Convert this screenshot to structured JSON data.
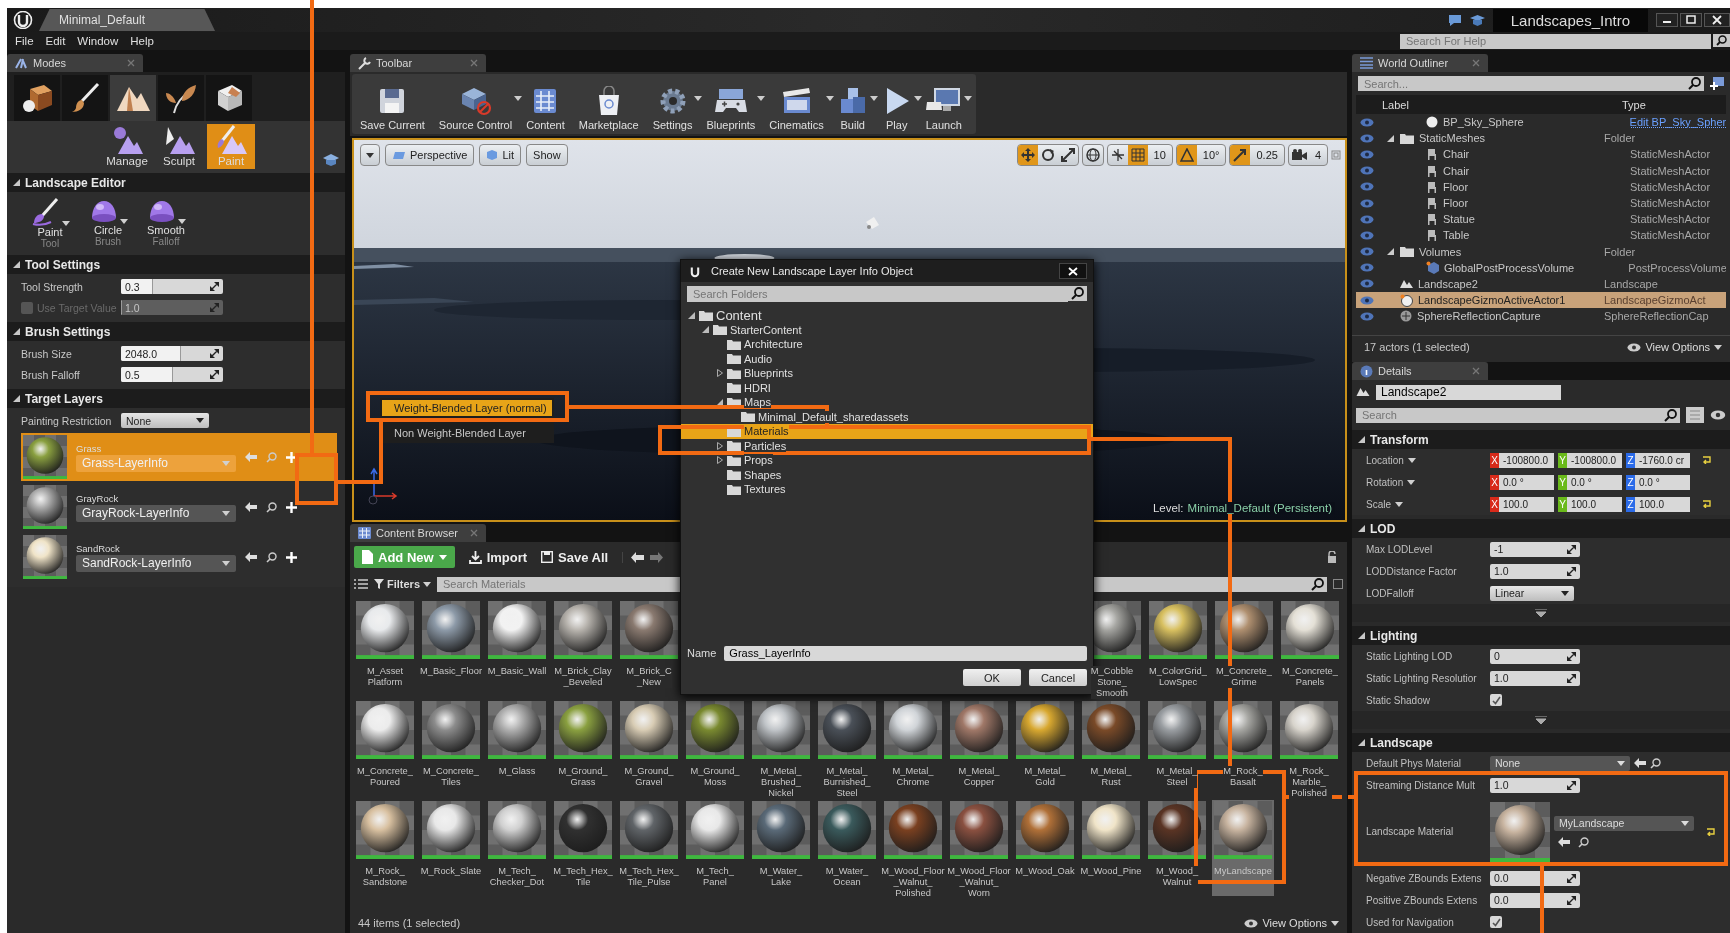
{
  "title_bar": {
    "document_tab": "Minimal_Default",
    "project": "Landscapes_Intro",
    "help_search": {
      "placeholder": "Search For Help"
    }
  },
  "menu": [
    "File",
    "Edit",
    "Window",
    "Help"
  ],
  "modes": {
    "tab": "Modes",
    "mode_buttons": [
      {
        "kind": "place",
        "selected": false
      },
      {
        "kind": "paint",
        "selected": false
      },
      {
        "kind": "landscape",
        "selected": true
      },
      {
        "kind": "foliage",
        "selected": false
      },
      {
        "kind": "geometry",
        "selected": false
      }
    ],
    "sub_modes": [
      {
        "kind": "manage",
        "label": "Manage",
        "selected": false
      },
      {
        "kind": "sculpt",
        "label": "Sculpt",
        "selected": false
      },
      {
        "kind": "paint",
        "label": "Paint",
        "selected": true
      }
    ],
    "landscape_editor": {
      "title": "Landscape Editor",
      "tools": [
        {
          "kind": "brush",
          "label": "Paint",
          "sublabel": "Tool"
        },
        {
          "kind": "dome",
          "label": "Circle",
          "sublabel": "Brush"
        },
        {
          "kind": "dome",
          "label": "Smooth",
          "sublabel": "Falloff"
        }
      ]
    },
    "tool_settings": {
      "title": "Tool Settings",
      "rows": [
        {
          "kind": "slider",
          "label": "Tool Strength",
          "value": "0.3",
          "level": 0.3,
          "disabled": false
        },
        {
          "kind": "checkbox-slider",
          "label": "Use Target Value",
          "value": "1.0",
          "level": 0,
          "disabled": true,
          "checked": false
        }
      ]
    },
    "brush_settings": {
      "title": "Brush Settings",
      "rows": [
        {
          "kind": "slider",
          "label": "Brush Size",
          "value": "2048.0",
          "level": 0.58,
          "disabled": false
        },
        {
          "kind": "slider",
          "label": "Brush Falloff",
          "value": "0.5",
          "level": 0.5,
          "disabled": false
        }
      ]
    },
    "target_layers": {
      "title": "Target Layers",
      "restriction": {
        "label": "Painting Restriction",
        "value": "None"
      },
      "layers": [
        {
          "name": "Grass",
          "info": "Grass-LayerInfo",
          "selected": true
        },
        {
          "name": "GrayRock",
          "info": "GrayRock-LayerInfo",
          "selected": false
        },
        {
          "name": "SandRock",
          "info": "SandRock-LayerInfo",
          "selected": false
        }
      ]
    }
  },
  "toolbar": {
    "tab": "Toolbar",
    "buttons": [
      {
        "kind": "save",
        "label": "Save Current",
        "dropdown": false
      },
      {
        "kind": "source-control",
        "label": "Source Control",
        "dropdown": true
      },
      {
        "kind": "content",
        "label": "Content",
        "dropdown": false
      },
      {
        "kind": "marketplace",
        "label": "Marketplace",
        "dropdown": false
      },
      {
        "kind": "settings",
        "label": "Settings",
        "dropdown": true
      },
      {
        "kind": "blueprints",
        "label": "Blueprints",
        "dropdown": true
      },
      {
        "kind": "cinematics",
        "label": "Cinematics",
        "dropdown": true
      },
      {
        "kind": "build",
        "label": "Build",
        "dropdown": true
      },
      {
        "kind": "play",
        "label": "Play",
        "dropdown": true
      },
      {
        "kind": "launch",
        "label": "Launch",
        "dropdown": true
      }
    ]
  },
  "viewport": {
    "view_buttons": [
      {
        "kind": "perspective",
        "label": "Perspective"
      },
      {
        "kind": "lit",
        "label": "Lit"
      },
      {
        "kind": "show",
        "label": "Show"
      }
    ],
    "transform_tools": [
      {
        "kind": "move",
        "selected": true
      },
      {
        "kind": "rotate",
        "selected": false
      },
      {
        "kind": "scale",
        "selected": false
      }
    ],
    "snaps": [
      {
        "kind": "grid",
        "value": "10",
        "on": true
      },
      {
        "kind": "rotation",
        "value": "10°",
        "on": true
      },
      {
        "kind": "scale",
        "value": "0.25",
        "on": true
      },
      {
        "kind": "camera-speed",
        "value": "4",
        "on": false
      }
    ],
    "level": {
      "label": "Level:",
      "name": "Minimal_Default (Persistent)"
    },
    "layer_menu": [
      {
        "label": "Weight-Blended Layer (normal)",
        "selected": true
      },
      {
        "label": "Non Weight-Blended Layer",
        "selected": false
      }
    ]
  },
  "content_browser": {
    "tab": "Content Browser",
    "add_new": "Add New",
    "import": "Import",
    "save_all": "Save All",
    "filters": "Filters",
    "search": {
      "placeholder": "Search Materials"
    },
    "first_row_left": [
      {
        "label": "M_Asset\nPlatform",
        "selected": false
      },
      {
        "label": "M_Basic_Floor",
        "selected": false
      },
      {
        "label": "M_Basic_Wall",
        "selected": false
      },
      {
        "label": "M_Brick_Clay\n_Beveled",
        "selected": false
      },
      {
        "label": "M_Brick_C\n_New",
        "selected": false
      }
    ],
    "first_row_right": [
      {
        "label": "M_Cobble\nStone_\nSmooth",
        "selected": false
      },
      {
        "label": "M_ColorGrid_\nLowSpec",
        "selected": false
      },
      {
        "label": "M_Concrete_\nGrime",
        "selected": false
      },
      {
        "label": "M_Concrete_\nPanels",
        "selected": false
      }
    ],
    "rows": [
      [
        {
          "label": "M_Concrete_\nPoured",
          "selected": false
        },
        {
          "label": "M_Concrete_\nTiles",
          "selected": false
        },
        {
          "label": "M_Glass",
          "selected": false
        },
        {
          "label": "M_Ground_\nGrass",
          "selected": false
        },
        {
          "label": "M_Ground_\nGravel",
          "selected": false
        },
        {
          "label": "M_Ground_\nMoss",
          "selected": false
        },
        {
          "label": "M_Metal_\nBrushed_\nNickel",
          "selected": false
        },
        {
          "label": "M_Metal_\nBurnished_\nSteel",
          "selected": false
        },
        {
          "label": "M_Metal_\nChrome",
          "selected": false
        },
        {
          "label": "M_Metal_\nCopper",
          "selected": false
        },
        {
          "label": "M_Metal_\nGold",
          "selected": false
        },
        {
          "label": "M_Metal_\nRust",
          "selected": false
        },
        {
          "label": "M_Metal_\nSteel",
          "selected": false
        },
        {
          "label": "M_Rock_\nBasalt",
          "selected": false
        },
        {
          "label": "M_Rock_\nMarble_\nPolished",
          "selected": false
        }
      ],
      [
        {
          "label": "M_Rock_\nSandstone",
          "selected": false
        },
        {
          "label": "M_Rock_Slate",
          "selected": false
        },
        {
          "label": "M_Tech_\nChecker_Dot",
          "selected": false
        },
        {
          "label": "M_Tech_Hex_\nTile",
          "selected": false
        },
        {
          "label": "M_Tech_Hex_\nTile_Pulse",
          "selected": false
        },
        {
          "label": "M_Tech_\nPanel",
          "selected": false
        },
        {
          "label": "M_Water_\nLake",
          "selected": false
        },
        {
          "label": "M_Water_\nOcean",
          "selected": false
        },
        {
          "label": "M_Wood_Floor\n_Walnut_\nPolished",
          "selected": false
        },
        {
          "label": "M_Wood_Floor\n_Walnut_\nWorn",
          "selected": false
        },
        {
          "label": "M_Wood_Oak",
          "selected": false
        },
        {
          "label": "M_Wood_Pine",
          "selected": false
        },
        {
          "label": "M_Wood_\nWalnut",
          "selected": false
        },
        {
          "label": "MyLandscape",
          "selected": true
        }
      ]
    ],
    "status": "44 items (1 selected)",
    "view_options": "View Options"
  },
  "dialog": {
    "title": "Create New Landscape Layer Info Object",
    "search": {
      "placeholder": "Search Folders"
    },
    "tree": [
      {
        "label": "Content",
        "kind": "expanded",
        "selected": false,
        "children": [
          {
            "label": "StarterContent",
            "kind": "expanded",
            "selected": false,
            "children": [
              {
                "label": "Architecture",
                "kind": "leaf",
                "selected": false
              },
              {
                "label": "Audio",
                "kind": "leaf",
                "selected": false
              },
              {
                "label": "Blueprints",
                "kind": "collapsed",
                "selected": false
              },
              {
                "label": "HDRI",
                "kind": "leaf",
                "selected": false
              },
              {
                "label": "Maps",
                "kind": "expanded",
                "selected": false,
                "children": [
                  {
                    "label": "Minimal_Default_sharedassets",
                    "kind": "leaf",
                    "selected": false
                  }
                ]
              },
              {
                "label": "Materials",
                "kind": "leaf",
                "selected": true
              },
              {
                "label": "Particles",
                "kind": "collapsed",
                "selected": false
              },
              {
                "label": "Props",
                "kind": "collapsed",
                "selected": false
              },
              {
                "label": "Shapes",
                "kind": "leaf",
                "selected": false
              },
              {
                "label": "Textures",
                "kind": "leaf",
                "selected": false
              }
            ]
          }
        ]
      }
    ],
    "name_label": "Name",
    "name_value": "Grass_LayerInfo",
    "buttons": [
      "OK",
      "Cancel"
    ]
  },
  "outliner": {
    "tab": "World Outliner",
    "search": {
      "placeholder": "Search..."
    },
    "columns": [
      "Label",
      "Type"
    ],
    "rows": [
      {
        "children": [
          {
            "kind": "sphere",
            "label": "BP_Sky_Sphere",
            "type": "Edit BP_Sky_Spher",
            "type_link": true,
            "selected": false
          }
        ]
      },
      {
        "kind": "folder",
        "label": "StaticMeshes",
        "type": "Folder",
        "type_link": false,
        "selected": false,
        "children": [
          {
            "kind": "mesh",
            "label": "Chair",
            "type": "StaticMeshActor",
            "type_link": false,
            "selected": false
          },
          {
            "kind": "mesh",
            "label": "Chair",
            "type": "StaticMeshActor",
            "type_link": false,
            "selected": false
          },
          {
            "kind": "mesh",
            "label": "Floor",
            "type": "StaticMeshActor",
            "type_link": false,
            "selected": false
          },
          {
            "kind": "mesh",
            "label": "Floor",
            "type": "StaticMeshActor",
            "type_link": false,
            "selected": false
          },
          {
            "kind": "mesh",
            "label": "Statue",
            "type": "StaticMeshActor",
            "type_link": false,
            "selected": false
          },
          {
            "kind": "mesh",
            "label": "Table",
            "type": "StaticMeshActor",
            "type_link": false,
            "selected": false
          }
        ]
      },
      {
        "kind": "folder",
        "label": "Volumes",
        "type": "Folder",
        "type_link": false,
        "selected": false,
        "children": [
          {
            "kind": "volume",
            "label": "GlobalPostProcessVolume",
            "type": "PostProcessVolume",
            "type_link": false,
            "selected": false
          }
        ]
      },
      {
        "kind": "landscape",
        "label": "Landscape2",
        "type": "Landscape",
        "type_link": false,
        "selected": false
      },
      {
        "kind": "gizmo",
        "label": "LandscapeGizmoActiveActor1",
        "type": "LandscapeGizmoAct",
        "type_link": false,
        "selected": true
      },
      {
        "kind": "reflection",
        "label": "SphereReflectionCapture",
        "type": "SphereReflectionCap",
        "type_link": false,
        "selected": false
      }
    ],
    "status": "17 actors (1 selected)",
    "view_options": "View Options"
  },
  "details": {
    "tab": "Details",
    "object_name": "Landscape2",
    "search": {
      "placeholder": "Search"
    },
    "sections": [
      {
        "title": "Transform",
        "advanced": false,
        "rows": [
          {
            "kind": "vector",
            "label": "Location",
            "reset": true,
            "values": [
              {
                "axis": "X",
                "value": "-100800.0"
              },
              {
                "axis": "Y",
                "value": "-100800.0"
              },
              {
                "axis": "Z",
                "value": "-1760.0 cr"
              }
            ]
          },
          {
            "kind": "vector",
            "label": "Rotation",
            "reset": false,
            "values": [
              {
                "axis": "X",
                "value": "0.0 °"
              },
              {
                "axis": "Y",
                "value": "0.0 °"
              },
              {
                "axis": "Z",
                "value": "0.0 °"
              }
            ]
          },
          {
            "kind": "vector",
            "label": "Scale",
            "reset": true,
            "values": [
              {
                "axis": "X",
                "value": "100.0"
              },
              {
                "axis": "Y",
                "value": "100.0"
              },
              {
                "axis": "Z",
                "value": "100.0"
              }
            ]
          }
        ]
      },
      {
        "title": "LOD",
        "advanced": true,
        "rows": [
          {
            "kind": "number",
            "label": "Max LODLevel",
            "value": "-1",
            "reset": false
          },
          {
            "kind": "number",
            "label": "LODDistance Factor",
            "value": "1.0",
            "reset": false
          },
          {
            "kind": "dropdown",
            "label": "LODFalloff",
            "value": "Linear",
            "reset": false
          }
        ]
      },
      {
        "title": "Lighting",
        "advanced": true,
        "rows": [
          {
            "kind": "number",
            "label": "Static Lighting LOD",
            "value": "0",
            "reset": false
          },
          {
            "kind": "number",
            "label": "Static Lighting Resolutior",
            "value": "1.0",
            "reset": false
          },
          {
            "kind": "checkbox",
            "label": "Static Shadow",
            "checked": true,
            "reset": false
          }
        ]
      },
      {
        "title": "Landscape",
        "advanced": false,
        "rows": [
          {
            "kind": "asset-dropdown",
            "label": "Default Phys Material",
            "value": "None",
            "reset": false
          },
          {
            "kind": "number",
            "label": "Streaming Distance Mult",
            "value": "1.0",
            "reset": false
          },
          {
            "kind": "asset",
            "label": "Landscape Material",
            "value": "MyLandscape",
            "reset": true
          },
          {
            "kind": "number",
            "label": "Negative ZBounds Extens",
            "value": "0.0",
            "reset": false
          },
          {
            "kind": "number",
            "label": "Positive ZBounds Extens",
            "value": "0.0",
            "reset": false
          },
          {
            "kind": "checkbox",
            "label": "Used for Navigation",
            "checked": true,
            "reset": false
          }
        ]
      }
    ]
  }
}
